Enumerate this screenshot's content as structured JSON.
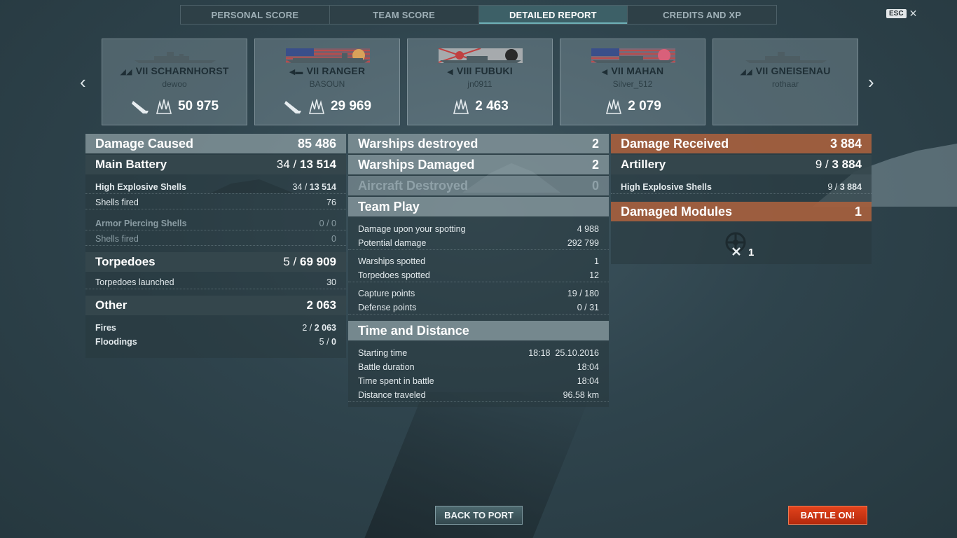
{
  "tabs": [
    {
      "label": "PERSONAL SCORE"
    },
    {
      "label": "TEAM SCORE"
    },
    {
      "label": "DETAILED REPORT"
    },
    {
      "label": "CREDITS AND XP"
    }
  ],
  "esc": {
    "key": "ESC",
    "close": "✕"
  },
  "nav": {
    "prev": "‹",
    "next": "›"
  },
  "ships": [
    {
      "tier": "VII",
      "name": "SCHARNHORST",
      "class_icon": "battleship-icon",
      "player": "dewoo",
      "kills_icon": "ship-sunk-icon",
      "damage": "50 975"
    },
    {
      "tier": "VII",
      "name": "RANGER",
      "class_icon": "carrier-icon",
      "player": "BASOUN",
      "kills_icon": "ship-sunk-icon",
      "damage": "29 969"
    },
    {
      "tier": "VIII",
      "name": "FUBUKI",
      "class_icon": "destroyer-icon",
      "player": "jn0911",
      "kills_icon": "",
      "damage": "2 463"
    },
    {
      "tier": "VII",
      "name": "MAHAN",
      "class_icon": "destroyer-icon",
      "player": "Silver_512",
      "kills_icon": "",
      "damage": "2 079"
    },
    {
      "tier": "VII",
      "name": "GNEISENAU",
      "class_icon": "battleship-icon",
      "player": "rothaar",
      "kills_icon": "",
      "damage": ""
    }
  ],
  "left": {
    "damage_caused": {
      "label": "Damage Caused",
      "value": "85 486"
    },
    "main_battery": {
      "label": "Main Battery",
      "hits": "34 / ",
      "value": "13 514"
    },
    "he_shells": {
      "label": "High Explosive Shells",
      "hits": "34 / ",
      "value": "13 514"
    },
    "he_fired": {
      "label": "Shells fired",
      "value": "76"
    },
    "ap_shells": {
      "label": "Armor Piercing Shells",
      "value": "0 / 0"
    },
    "ap_fired": {
      "label": "Shells fired",
      "value": "0"
    },
    "torpedoes": {
      "label": "Torpedoes",
      "hits": "5 / ",
      "value": "69 909"
    },
    "torp_launched": {
      "label": "Torpedoes launched",
      "value": "30"
    },
    "other": {
      "label": "Other",
      "value": "2 063"
    },
    "fires": {
      "label": "Fires",
      "hits": "2 / ",
      "value": "2 063"
    },
    "floodings": {
      "label": "Floodings",
      "hits": "5 / ",
      "value": "0"
    }
  },
  "middle": {
    "warships_destroyed": {
      "label": "Warships destroyed",
      "value": "2"
    },
    "warships_damaged": {
      "label": "Warships Damaged",
      "value": "2"
    },
    "aircraft_destroyed": {
      "label": "Aircraft Destroyed",
      "value": "0"
    },
    "team_play": {
      "label": "Team Play"
    },
    "spot_damage": {
      "label": "Damage upon your spotting",
      "value": "4 988"
    },
    "potential_damage": {
      "label": "Potential damage",
      "value": "292 799"
    },
    "warships_spotted": {
      "label": "Warships spotted",
      "value": "1"
    },
    "torpedoes_spotted": {
      "label": "Torpedoes spotted",
      "value": "12"
    },
    "capture_points": {
      "label": "Capture points",
      "value": "19 / 180"
    },
    "defense_points": {
      "label": "Defense points",
      "value": "0 / 31"
    },
    "time_distance": {
      "label": "Time and Distance"
    },
    "starting_time": {
      "label": "Starting time",
      "value": "18:18  25.10.2016"
    },
    "battle_duration": {
      "label": "Battle duration",
      "value": "18:04"
    },
    "time_spent": {
      "label": "Time spent in battle",
      "value": "18:04"
    },
    "distance": {
      "label": "Distance traveled",
      "value": "96.58 km"
    }
  },
  "right": {
    "damage_received": {
      "label": "Damage Received",
      "value": "3 884"
    },
    "artillery": {
      "label": "Artillery",
      "hits": "9 / ",
      "value": "3 884"
    },
    "he_shells": {
      "label": "High Explosive Shells",
      "hits": "9 / ",
      "value": "3 884"
    },
    "damaged_modules": {
      "label": "Damaged Modules",
      "value": "1"
    },
    "module_icon": "steering-gear-icon",
    "module_count": "1"
  },
  "buttons": {
    "back_to_port": "BACK TO PORT",
    "battle_on": "BATTLE ON!"
  },
  "colors": {
    "accent_teal": "#3d6067",
    "damage_received_header": "#a8603e",
    "battle_button": "#d23a16"
  }
}
